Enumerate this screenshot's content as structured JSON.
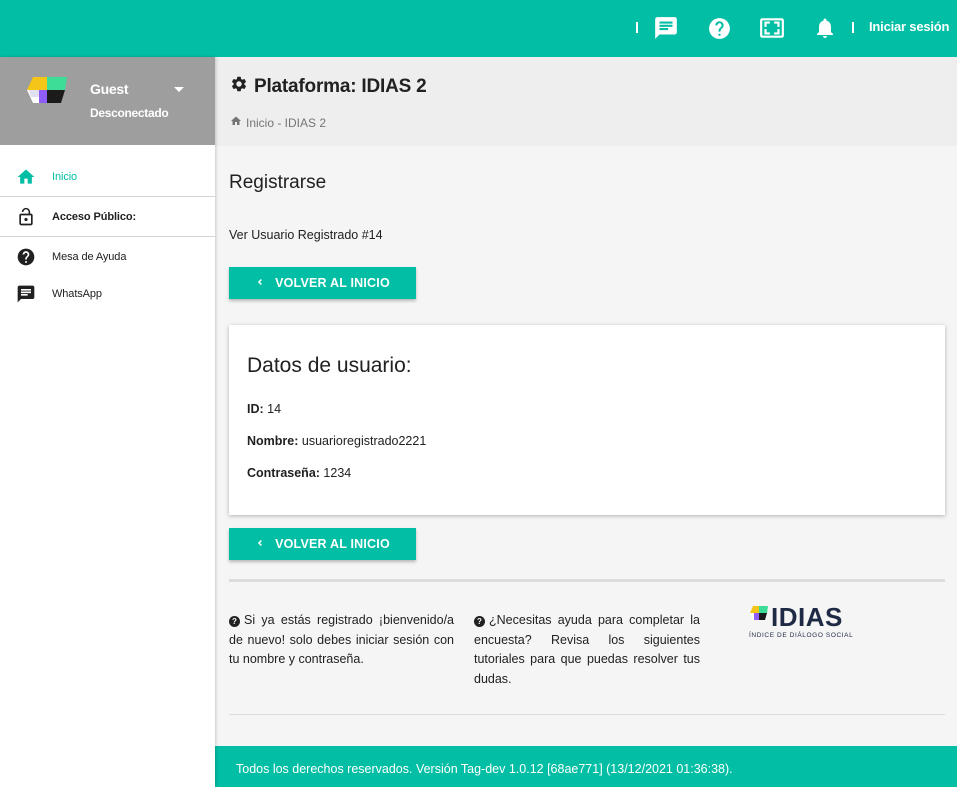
{
  "topbar": {
    "icons": [
      "chat-icon",
      "help-icon",
      "fullscreen-icon",
      "notifications-icon"
    ],
    "login_label": "Iniciar sesión"
  },
  "sidebar": {
    "user_name": "Guest",
    "user_status": "Desconectado",
    "items": [
      {
        "label": "Inicio",
        "icon": "home-icon",
        "active": true
      },
      {
        "label": "Acceso Público:",
        "icon": "lock-open-icon",
        "bold": true
      },
      {
        "label": "Mesa de Ayuda",
        "icon": "help-icon"
      },
      {
        "label": "WhatsApp",
        "icon": "chat-icon"
      }
    ]
  },
  "header": {
    "title": "Plataforma: IDIAS 2",
    "breadcrumb": "Inicio - IDIAS 2"
  },
  "main": {
    "section_title": "Registrarse",
    "subtitle": "Ver Usuario Registrado #14",
    "back_button": "VOLVER AL INICIO",
    "card": {
      "title": "Datos de usuario:",
      "id_label": "ID:",
      "id_value": "14",
      "name_label": "Nombre:",
      "name_value": "usuarioregistrado2221",
      "password_label": "Contraseña:",
      "password_value": "1234"
    },
    "info_left": "Si ya estás registrado ¡bienvenido/a de nuevo! solo debes iniciar sesión con tu nombre y contraseña.",
    "info_right": "¿Necesitas ayuda para completar la encuesta? Revisa los siguientes tutoriales para que puedas resolver tus dudas.",
    "brand_name": "IDIAS",
    "brand_tagline": "ÍNDICE DE DIÁLOGO SOCIAL"
  },
  "footer": {
    "text": "Todos los derechos reservados. Versión Tag-dev 1.0.12 [68ae771] (13/12/2021 01:36:38)."
  },
  "colors": {
    "accent": "#01bea4",
    "sidebar_header": "#9e9e9e",
    "header_bg": "#eeeeee"
  }
}
